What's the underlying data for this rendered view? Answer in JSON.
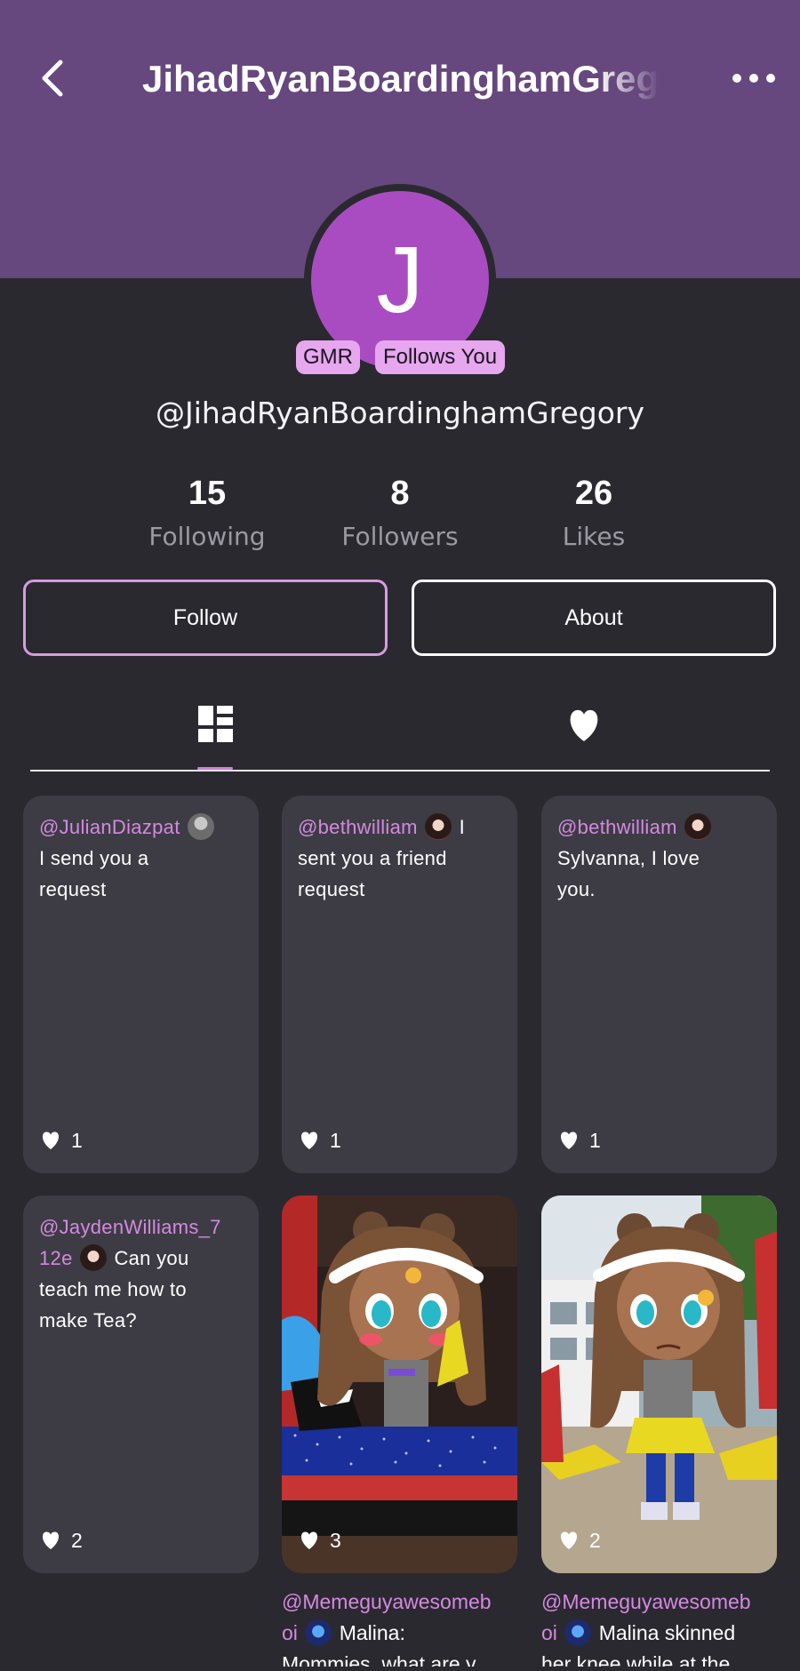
{
  "header": {
    "title": "JihadRyanBoardinghamGregory",
    "back_icon": "chevron-left-icon",
    "more_icon": "more-horizontal-icon",
    "background_color": "#66477e"
  },
  "profile": {
    "avatar_letter": "J",
    "avatar_color": "#aa4cc1",
    "badges": [
      "GMR",
      "Follows You"
    ],
    "handle": "@JihadRyanBoardinghamGregory"
  },
  "stats": [
    {
      "value": "15",
      "label": "Following"
    },
    {
      "value": "8",
      "label": "Followers"
    },
    {
      "value": "26",
      "label": "Likes"
    }
  ],
  "buttons": {
    "follow": "Follow",
    "about": "About"
  },
  "tabs": [
    {
      "name": "posts",
      "icon": "dashboard-grid-icon",
      "active": true
    },
    {
      "name": "likes",
      "icon": "heart-icon",
      "active": false
    }
  ],
  "posts": [
    {
      "author": "@JulianDiazpat",
      "text_lines": [
        "I send you a",
        "request"
      ],
      "likes": "1",
      "avatar_icon": "grey-avatar-icon"
    },
    {
      "author": "@bethwilliam",
      "text_after_avatar": "I",
      "text_lines": [
        "sent you a friend",
        "request"
      ],
      "likes": "1",
      "avatar_icon": "dark-hair-avatar-icon"
    },
    {
      "author": "@bethwilliam",
      "text_lines": [
        "Sylvanna, I love",
        "you."
      ],
      "likes": "1",
      "avatar_icon": "dark-hair-avatar-icon"
    },
    {
      "author_line1": "@JaydenWilliams_7",
      "author_line2": "12e",
      "text_after_avatar": "Can you",
      "text_lines": [
        "teach me how to",
        "make Tea?"
      ],
      "likes": "2",
      "avatar_icon": "dark-hair-avatar-icon"
    },
    {
      "likes": "3",
      "image": "character-art-image",
      "caption_author": "@Memeguyawesomeb",
      "caption_author2": "oi",
      "caption_after_avatar": "Malina:",
      "caption_line2": "Mommies, what are y...",
      "avatar_icon": "blue-avatar-icon"
    },
    {
      "likes": "2",
      "image": "character-art-playground-image",
      "caption_author": "@Memeguyawesomeb",
      "caption_author2": "oi",
      "caption_after_avatar": "Malina skinned",
      "caption_line2": "her knee while at the...",
      "avatar_icon": "blue-avatar-icon"
    }
  ],
  "colors": {
    "background": "#2a2930",
    "card": "#3d3c44",
    "accent": "#d489e0",
    "badge": "#e6a7ef"
  }
}
